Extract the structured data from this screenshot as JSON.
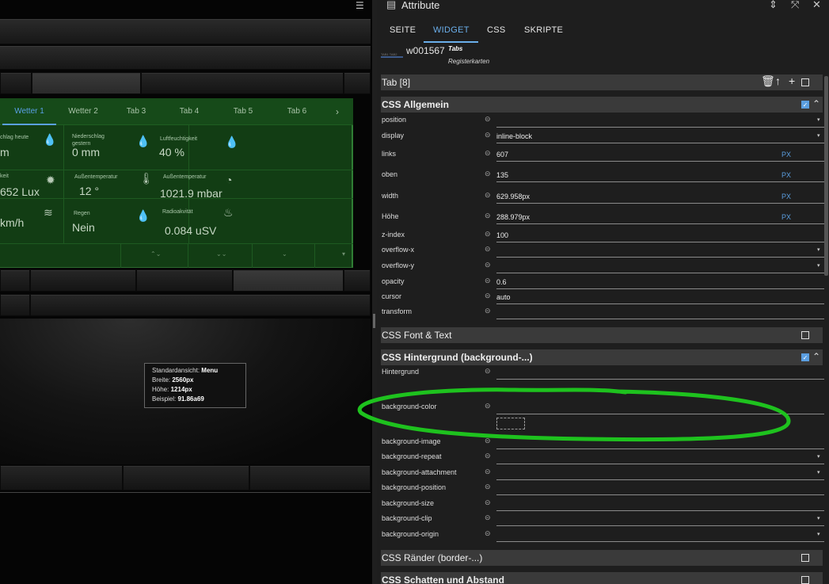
{
  "canvas": {
    "tabs": [
      "Wetter 1",
      "Wetter 2",
      "Tab 3",
      "Tab 4",
      "Tab 5",
      "Tab 6"
    ],
    "tabs_more": "›",
    "cells": [
      {
        "label": "chlag heute",
        "value": "m",
        "icon": "rain-drops-icon"
      },
      {
        "label": "Niederschlag gestern",
        "value": "0 mm",
        "icon": "rain-drops-icon"
      },
      {
        "label": "Luftfeuchtigkeit",
        "value": "40 %",
        "icon": "humidity-drops-icon"
      },
      {
        "label": "keit",
        "value": "652 Lux",
        "icon": "sun-icon"
      },
      {
        "label": "Außentemperatur",
        "value": "12 °",
        "icon": "thermometer-icon"
      },
      {
        "label": "Außentemperatur",
        "value": "1021.9 mbar",
        "icon": "gauge-icon"
      },
      {
        "label": "",
        "value": "km/h",
        "icon": "wind-icon"
      },
      {
        "label": "Regen",
        "value": "Nein",
        "icon": "rain-drops-icon"
      },
      {
        "label": "Radioakvität",
        "value": "0.084 uSV",
        "icon": "radiation-icon"
      }
    ],
    "tooltip": {
      "l1_key": "Standardansicht:",
      "l1_val": "Menu",
      "l2_key": "Breite:",
      "l2_val": "2560px",
      "l3_key": "Höhe:",
      "l3_val": "1214px",
      "l4_key": "Beispiel:",
      "l4_val": "91.86a69"
    }
  },
  "panel": {
    "title": "Attribute",
    "tabs": [
      "SEITE",
      "WIDGET",
      "CSS",
      "SKRIPTE"
    ],
    "active_tab": "WIDGET",
    "widget": {
      "id": "w001567",
      "type": "Tabs",
      "set": "Registerkarten",
      "thumb_text": "TAB1 TAB2"
    },
    "tab_group": "Tab [8]",
    "css_allgemein": {
      "title": "CSS Allgemein",
      "rows": [
        {
          "label": "position",
          "value": "",
          "dropdown": true
        },
        {
          "label": "display",
          "value": "inline-block",
          "dropdown": true
        },
        {
          "label": "links",
          "value": "607",
          "unit": "PX"
        },
        {
          "label": "oben",
          "value": "135",
          "unit": "PX"
        },
        {
          "label": "width",
          "value": "629.958px",
          "unit": "PX"
        },
        {
          "label": "Höhe",
          "value": "288.979px",
          "unit": "PX"
        },
        {
          "label": "z-index",
          "value": "100"
        },
        {
          "label": "overflow-x",
          "value": "",
          "dropdown": true
        },
        {
          "label": "overflow-y",
          "value": "",
          "dropdown": true
        },
        {
          "label": "opacity",
          "value": "0.6"
        },
        {
          "label": "cursor",
          "value": "auto"
        },
        {
          "label": "transform",
          "value": ""
        }
      ]
    },
    "css_font": {
      "title": "CSS Font & Text"
    },
    "css_background": {
      "title": "CSS Hintergrund (background-...)",
      "rows": [
        {
          "label": "Hintergrund",
          "value": ""
        },
        {
          "label": "background-color",
          "value": ""
        },
        {
          "label": "background-image",
          "value": ""
        },
        {
          "label": "background-repeat",
          "value": "",
          "dropdown": true
        },
        {
          "label": "background-attachment",
          "value": "",
          "dropdown": true
        },
        {
          "label": "background-position",
          "value": ""
        },
        {
          "label": "background-size",
          "value": ""
        },
        {
          "label": "background-clip",
          "value": "",
          "dropdown": true
        },
        {
          "label": "background-origin",
          "value": "",
          "dropdown": true
        }
      ]
    },
    "css_border": {
      "title": "CSS Ränder (border-...)"
    },
    "css_shadow": {
      "title": "CSS Schatten und Abstand"
    },
    "highlight_color": "#1ec21e",
    "accent_color": "#5b9ee0"
  }
}
